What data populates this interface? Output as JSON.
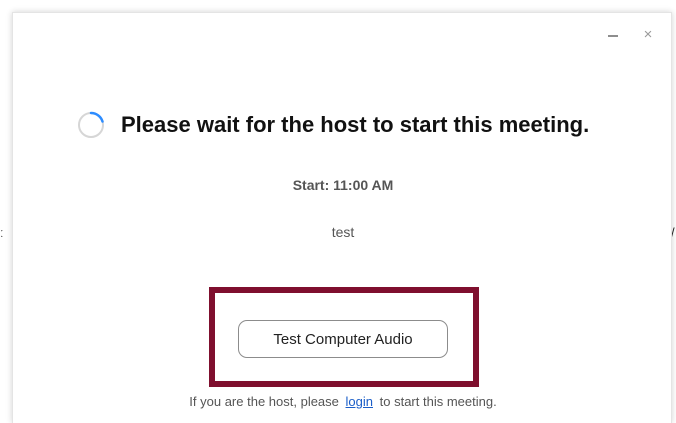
{
  "edges": {
    "left_char": "ː",
    "right_char": "/"
  },
  "window": {
    "minimize_label": "–",
    "close_label": "×"
  },
  "status": {
    "title": "Please wait for the host to start this meeting.",
    "spinner_color": "#2d8cff"
  },
  "meeting": {
    "start": "Start: 11:00 AM",
    "topic": "test"
  },
  "actions": {
    "test_audio_label": "Test Computer Audio"
  },
  "footer": {
    "prefix": "If you are the host, please",
    "link_label": "login",
    "suffix": "to start this meeting."
  },
  "colors": {
    "highlight_border": "#7f0f2e",
    "link": "#1a5dc8"
  }
}
